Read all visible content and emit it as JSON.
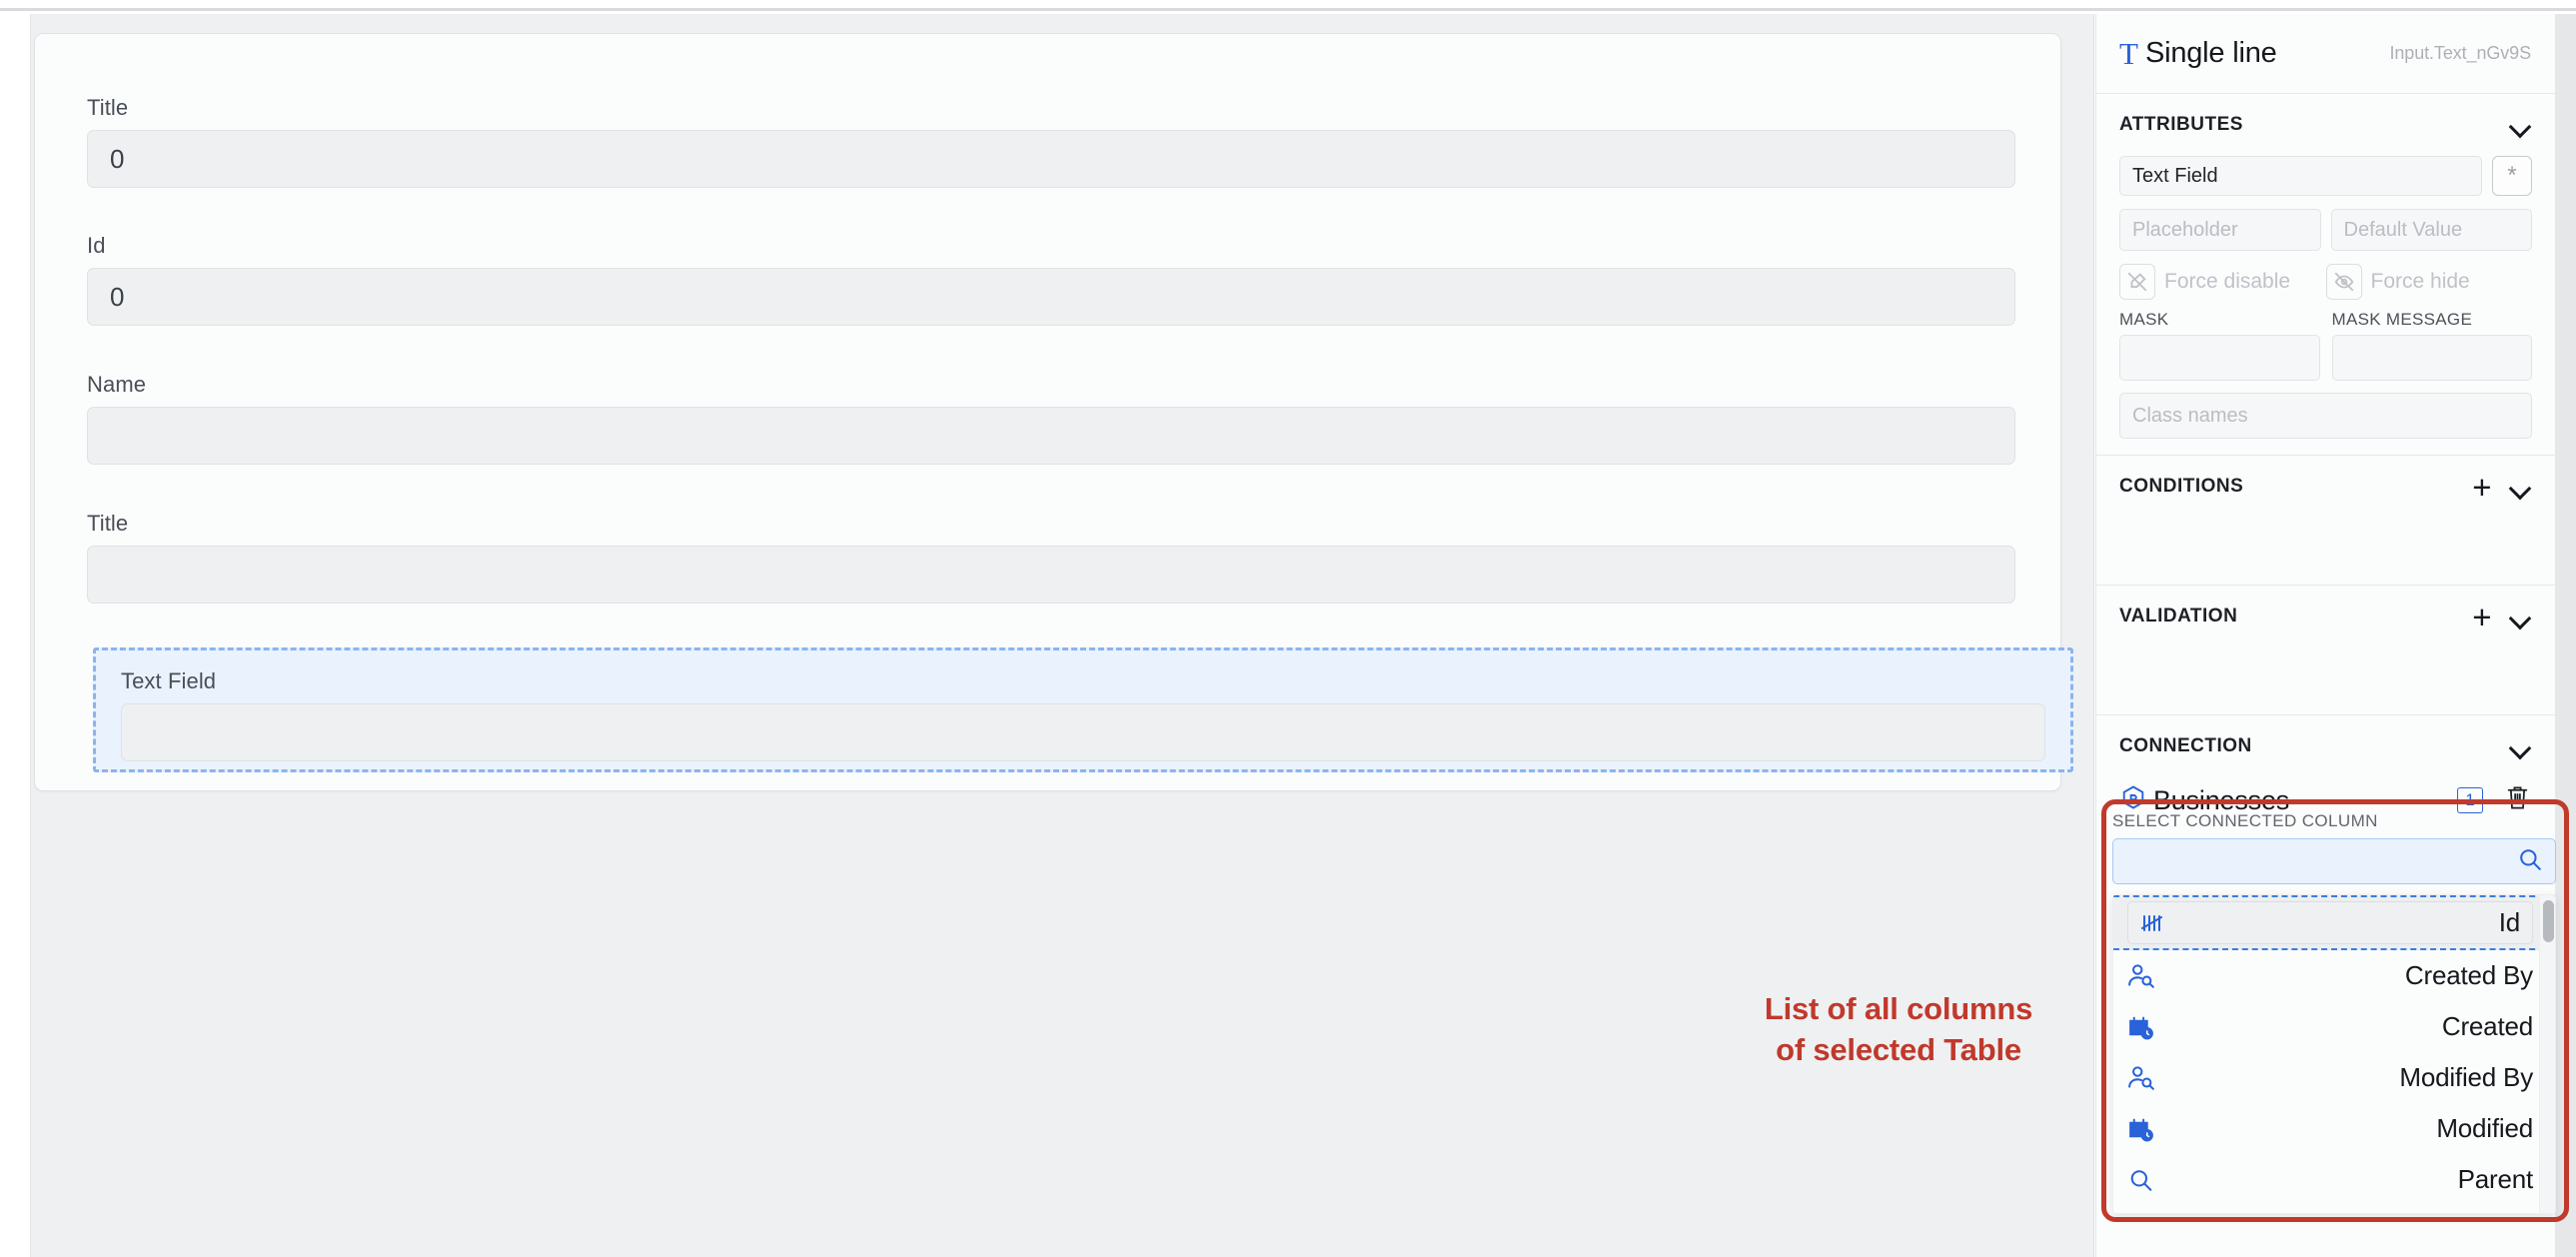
{
  "canvas": {
    "fields": [
      {
        "label": "Title",
        "value": "0"
      },
      {
        "label": "Id",
        "value": "0"
      },
      {
        "label": "Name",
        "value": ""
      },
      {
        "label": "Title",
        "value": ""
      }
    ],
    "selected_widget": {
      "label": "Text Field",
      "value": ""
    },
    "annotation": "List of all columns\nof selected Table",
    "annotation_color": "#c0392b"
  },
  "panel": {
    "title": "Single line",
    "component_id": "Input.Text_nGv9S",
    "icon": "text-type-icon",
    "accent_color": "#2962d9",
    "sections": {
      "attributes": {
        "header": "ATTRIBUTES",
        "label_value": "Text Field",
        "star_button": "*",
        "placeholder_field": "Placeholder",
        "default_value_field": "Default Value",
        "force_disable": "Force disable",
        "force_hide": "Force hide",
        "mask_caption": "MASK",
        "mask_value": "",
        "mask_message_caption": "MASK MESSAGE",
        "mask_message_value": "",
        "class_names_placeholder": "Class names"
      },
      "conditions": {
        "header": "CONDITIONS",
        "add": "+"
      },
      "validation": {
        "header": "VALIDATION",
        "add": "+"
      },
      "connection": {
        "header": "CONNECTION",
        "table_name": "Businesses",
        "table_badge": "1",
        "dropdown": {
          "caption": "SELECT CONNECTED COLUMN",
          "search_value": "",
          "items": [
            {
              "label": "Id",
              "icon": "tally-count-icon",
              "dragging": true
            },
            {
              "label": "Created By",
              "icon": "user-search-icon",
              "dragging": false
            },
            {
              "label": "Created",
              "icon": "calendar-clock-icon",
              "dragging": false
            },
            {
              "label": "Modified By",
              "icon": "user-search-icon",
              "dragging": false
            },
            {
              "label": "Modified",
              "icon": "calendar-clock-icon",
              "dragging": false
            },
            {
              "label": "Parent",
              "icon": "search-icon",
              "dragging": false
            }
          ]
        }
      }
    }
  }
}
